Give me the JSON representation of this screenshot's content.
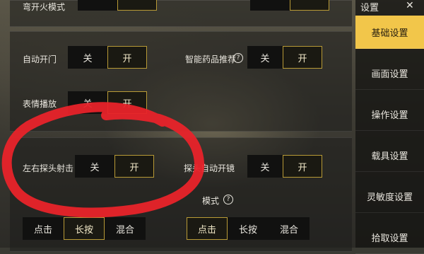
{
  "settings": {
    "row_top_label": "弯开火模式",
    "auto_door": {
      "label": "自动开门",
      "off": "关",
      "on": "开",
      "selected": "开"
    },
    "smart_medicine": {
      "label": "智能药品推荐",
      "help": "?",
      "off": "关",
      "on": "开",
      "selected": "开"
    },
    "emote": {
      "label": "表情播放",
      "off": "关",
      "on": "开",
      "selected": "开"
    },
    "peek_fire": {
      "label": "左右探头射击",
      "off": "关",
      "on": "开",
      "selected": "开"
    },
    "peek_scope": {
      "label": "探头自动开镜",
      "off": "关",
      "on": "开",
      "selected": "开"
    },
    "mode_left": {
      "options": [
        "点击",
        "长按",
        "混合"
      ],
      "selected": "长按"
    },
    "mode_right": {
      "label": "模式",
      "help": "?",
      "options": [
        "点击",
        "长按",
        "混合"
      ],
      "selected": "点击"
    }
  },
  "menu": {
    "title": "设置",
    "close": "✕",
    "tabs": [
      {
        "label": "基础设置",
        "active": true
      },
      {
        "label": "画面设置",
        "active": false
      },
      {
        "label": "操作设置",
        "active": false
      },
      {
        "label": "载具设置",
        "active": false
      },
      {
        "label": "灵敏度设置",
        "active": false
      },
      {
        "label": "拾取设置",
        "active": false
      }
    ]
  },
  "colors": {
    "accent": "#f2c64a",
    "selected_border": "#b89a36",
    "annotation": "#e8232a"
  }
}
